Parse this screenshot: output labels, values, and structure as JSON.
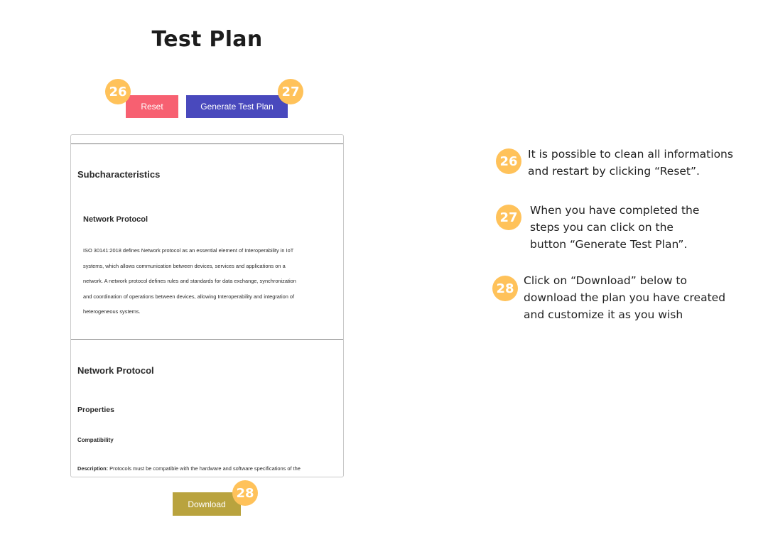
{
  "page": {
    "title": "Test Plan"
  },
  "buttons": {
    "reset": "Reset",
    "generate": "Generate Test Plan",
    "download": "Download"
  },
  "badges": {
    "reset": "26",
    "generate": "27",
    "download": "28"
  },
  "panel": {
    "subcharacteristics_heading": "Subcharacteristics",
    "network_protocol_heading": "Network Protocol",
    "description_lines": [
      "ISO 30141:2018 defines Network protocol as an essential element of Interoperability in IoT",
      "systems, which allows communication between devices, services and applications on a",
      "network. A network protocol defines rules and standards for data exchange, synchronization",
      "and coordination of operations between devices, allowing Interoperability and integration of",
      "heterogeneous systems."
    ],
    "section_heading": "Network Protocol",
    "properties_heading": "Properties",
    "compatibility_heading": "Compatibility",
    "description_label": "Description:",
    "description_text": " Protocols must be compatible with the hardware and software specifications of the"
  },
  "notes": [
    {
      "badge": "26",
      "lines": [
        "It is possible to clean all informations",
        "and restart by clicking “Reset”."
      ]
    },
    {
      "badge": "27",
      "lines": [
        "When you have completed the",
        "steps you can click on the",
        "button “Generate Test Plan”."
      ]
    },
    {
      "badge": "28",
      "lines": [
        "Click on “Download” below to",
        "download the plan you have created",
        "and customize it as you wish"
      ]
    }
  ],
  "colors": {
    "reset": "#f76071",
    "generate": "#4949bd",
    "download": "#b9a33e",
    "badge": "#ffc25a"
  }
}
